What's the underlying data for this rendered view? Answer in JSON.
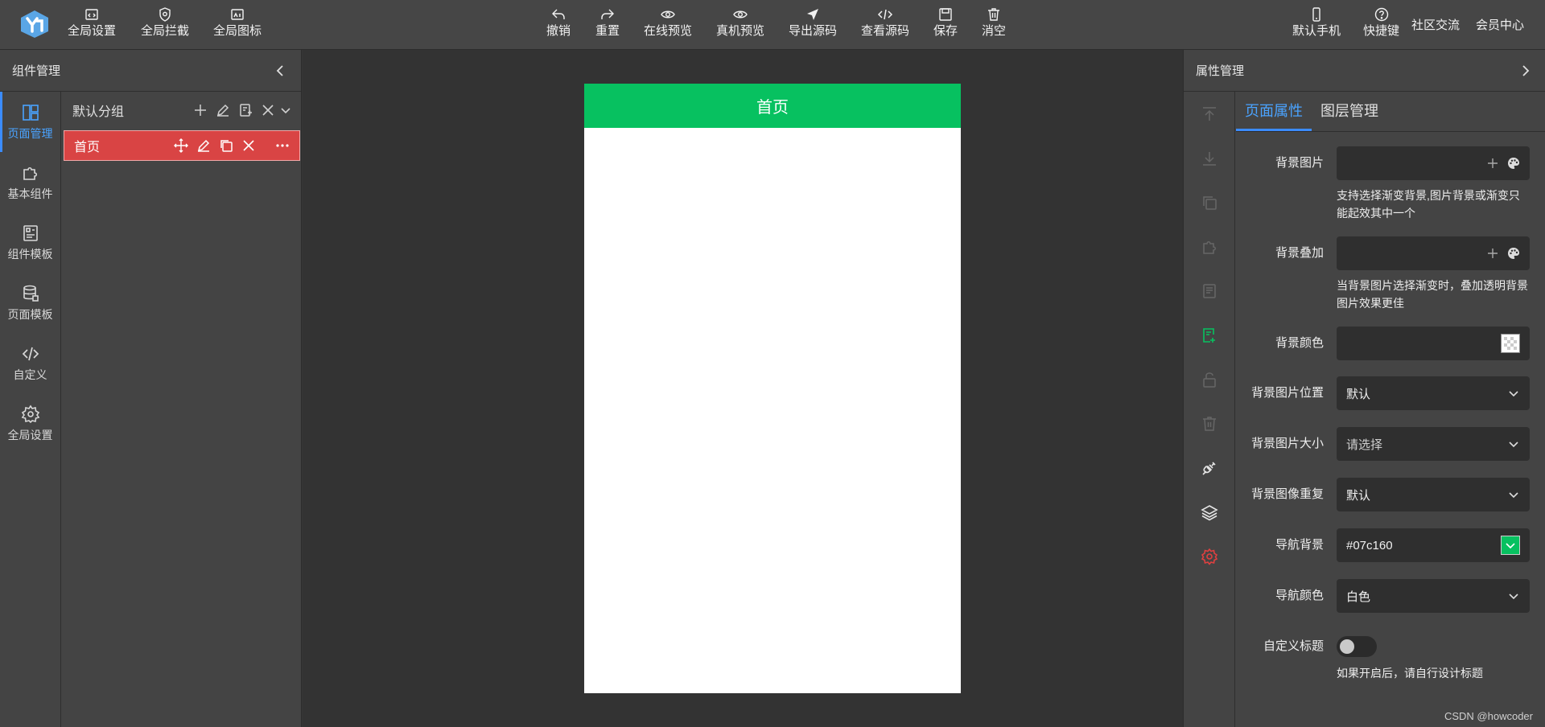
{
  "toolbar": {
    "left": [
      {
        "label": "全局设置",
        "icon": "code-window-icon"
      },
      {
        "label": "全局拦截",
        "icon": "shield-icon"
      },
      {
        "label": "全局图标",
        "icon": "image-icon"
      }
    ],
    "center": [
      {
        "label": "撤销",
        "icon": "undo-icon"
      },
      {
        "label": "重置",
        "icon": "redo-icon"
      },
      {
        "label": "在线预览",
        "icon": "eye-icon"
      },
      {
        "label": "真机预览",
        "icon": "eye-icon"
      },
      {
        "label": "导出源码",
        "icon": "send-icon"
      },
      {
        "label": "查看源码",
        "icon": "code-icon"
      },
      {
        "label": "保存",
        "icon": "save-icon"
      },
      {
        "label": "消空",
        "icon": "trash-icon"
      }
    ],
    "right": {
      "device": "默认手机",
      "shortcuts": "快捷键",
      "community": "社区交流",
      "member": "会员中心"
    }
  },
  "left_panel": {
    "title": "组件管理",
    "rail": [
      "页面管理",
      "基本组件",
      "组件模板",
      "页面模板",
      "自定义",
      "全局设置"
    ],
    "group_name": "默认分组",
    "page_name": "首页"
  },
  "canvas": {
    "page_title": "首页",
    "nav_color": "#07c160"
  },
  "right_panel": {
    "title": "属性管理",
    "tabs": [
      "页面属性",
      "图层管理"
    ],
    "fields": {
      "bg_image": {
        "label": "背景图片",
        "hint": "支持选择渐变背景,图片背景或渐变只能起效其中一个"
      },
      "bg_overlay": {
        "label": "背景叠加",
        "hint": "当背景图片选择渐变时，叠加透明背景图片效果更佳"
      },
      "bg_color": {
        "label": "背景颜色"
      },
      "bg_position": {
        "label": "背景图片位置",
        "value": "默认"
      },
      "bg_size": {
        "label": "背景图片大小",
        "value": "请选择"
      },
      "bg_repeat": {
        "label": "背景图像重复",
        "value": "默认"
      },
      "nav_bg": {
        "label": "导航背景",
        "value": "#07c160"
      },
      "nav_color": {
        "label": "导航颜色",
        "value": "白色"
      },
      "custom_title": {
        "label": "自定义标题",
        "hint": "如果开启后，请自行设计标题"
      }
    }
  },
  "watermark": "CSDN @howcoder",
  "colors": {
    "accent": "#3b8cff",
    "active_page": "#d94444",
    "nav_green": "#07c160"
  }
}
